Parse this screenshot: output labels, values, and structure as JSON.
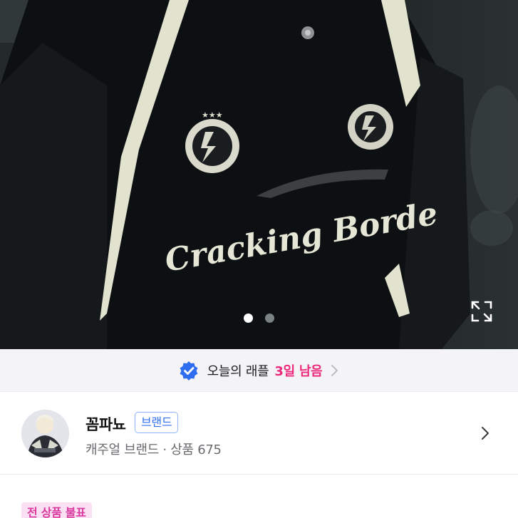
{
  "photo": {
    "garment_print": "Cracking Borde",
    "pager_count": 2,
    "pager_active_index": 0,
    "expand_icon": "expand-icon"
  },
  "raffle": {
    "icon": "verified-check-icon",
    "label": "오늘의 래플",
    "remaining": "3일 남음",
    "accent_color": "#ec2a7c"
  },
  "shop": {
    "avatar": "shop-avatar",
    "name": "꼼파뇨",
    "badge": "브랜드",
    "meta": "캐주얼 브랜드 · 상품 675"
  },
  "tags": {
    "chip": "전 상품 불표"
  }
}
